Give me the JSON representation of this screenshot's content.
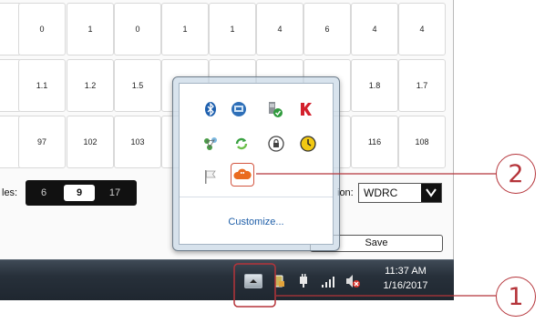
{
  "grid": {
    "row1": [
      "",
      "0",
      "1",
      "0",
      "1",
      "1",
      "4",
      "6",
      "4",
      "4"
    ],
    "row2": [
      "",
      "1.1",
      "1.2",
      "1.5",
      "",
      "",
      "",
      "",
      "1.8",
      "1.7"
    ],
    "row3": [
      "",
      "97",
      "102",
      "103",
      "",
      "",
      "",
      "",
      "116",
      "108"
    ]
  },
  "row_label": "les:",
  "segments": [
    "6",
    "9",
    "17"
  ],
  "selected_segment": "9",
  "select_label": "ion:",
  "select_value": "WDRC",
  "save_label": "Save",
  "popup": {
    "customize_label": "Customize..."
  },
  "taskbar": {
    "time": "11:37 AM",
    "date": "1/16/2017"
  },
  "callouts": [
    "1",
    "2"
  ],
  "icons": {
    "popup": [
      "bluetooth-icon",
      "network-sharing-icon",
      "safely-remove-hardware-icon",
      "antivirus-icon",
      "network-status-icon",
      "sync-icon",
      "lock-icon",
      "clock-app-icon",
      "action-center-flag-icon",
      "cloud-icon"
    ],
    "taskbar": [
      "show-hidden-icons-button",
      "battery-lock-icon",
      "power-icon",
      "signal-icon",
      "volume-muted-icon"
    ]
  },
  "colors": {
    "callout": "#b5343a",
    "link": "#1e5ea8",
    "highlight": "#d3553f"
  }
}
